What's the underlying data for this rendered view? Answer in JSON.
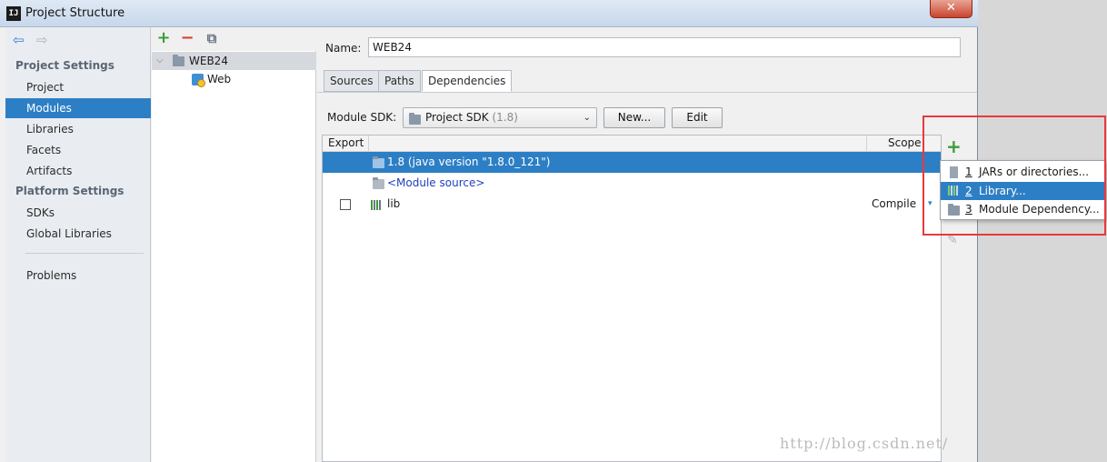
{
  "window": {
    "title": "Project Structure",
    "logo_text": "IJ",
    "close_glyph": "✕"
  },
  "nav": {
    "back_glyph": "⇦",
    "forward_glyph": "⇨",
    "project_settings_heading": "Project Settings",
    "platform_settings_heading": "Platform Settings",
    "items": {
      "project": "Project",
      "modules": "Modules",
      "libraries": "Libraries",
      "facets": "Facets",
      "artifacts": "Artifacts",
      "sdks": "SDKs",
      "global_libraries": "Global Libraries",
      "problems": "Problems"
    },
    "selected": "Modules"
  },
  "tree": {
    "toolbar": {
      "add_glyph": "+",
      "remove_glyph": "−",
      "copy_glyph": "⧉"
    },
    "chevron": "⌵",
    "nodes": [
      {
        "label": "WEB24",
        "icon": "module-folder-icon",
        "selected": true
      },
      {
        "label": "Web",
        "icon": "web-facet-icon",
        "selected": false
      }
    ]
  },
  "main": {
    "name_label": "Name:",
    "name_value": "WEB24",
    "tabs": [
      "Sources",
      "Paths",
      "Dependencies"
    ],
    "active_tab": "Dependencies",
    "module_sdk_label": "Module SDK:",
    "sdk_select": {
      "label": "Project SDK",
      "version": "(1.8)",
      "caret": "⌄"
    },
    "new_button": "New...",
    "edit_button": "Edit",
    "table": {
      "headers": {
        "export": "Export",
        "scope": "Scope"
      },
      "rows": [
        {
          "label": "1.8 (java version \"1.8.0_121\")",
          "scope": "",
          "selected": true
        },
        {
          "label": "<Module source>",
          "scope": "",
          "selected": false
        },
        {
          "label": "lib",
          "scope": "Compile",
          "selected": false
        }
      ],
      "scope_caret": "▾"
    },
    "side_toolbar": {
      "add_glyph": "+",
      "edit_glyph": "✎"
    }
  },
  "popup": {
    "items": [
      {
        "num": "1",
        "label": "JARs or directories...",
        "selected": false
      },
      {
        "num": "2",
        "label": "Library...",
        "selected": true
      },
      {
        "num": "3",
        "label": "Module Dependency...",
        "selected": false
      }
    ]
  },
  "watermark": "http://blog.csdn.net/",
  "colors": {
    "selection": "#2d7fc5",
    "annotation_red": "#e8393b",
    "add_green": "#3c9c3c",
    "remove_red": "#d9412f"
  }
}
